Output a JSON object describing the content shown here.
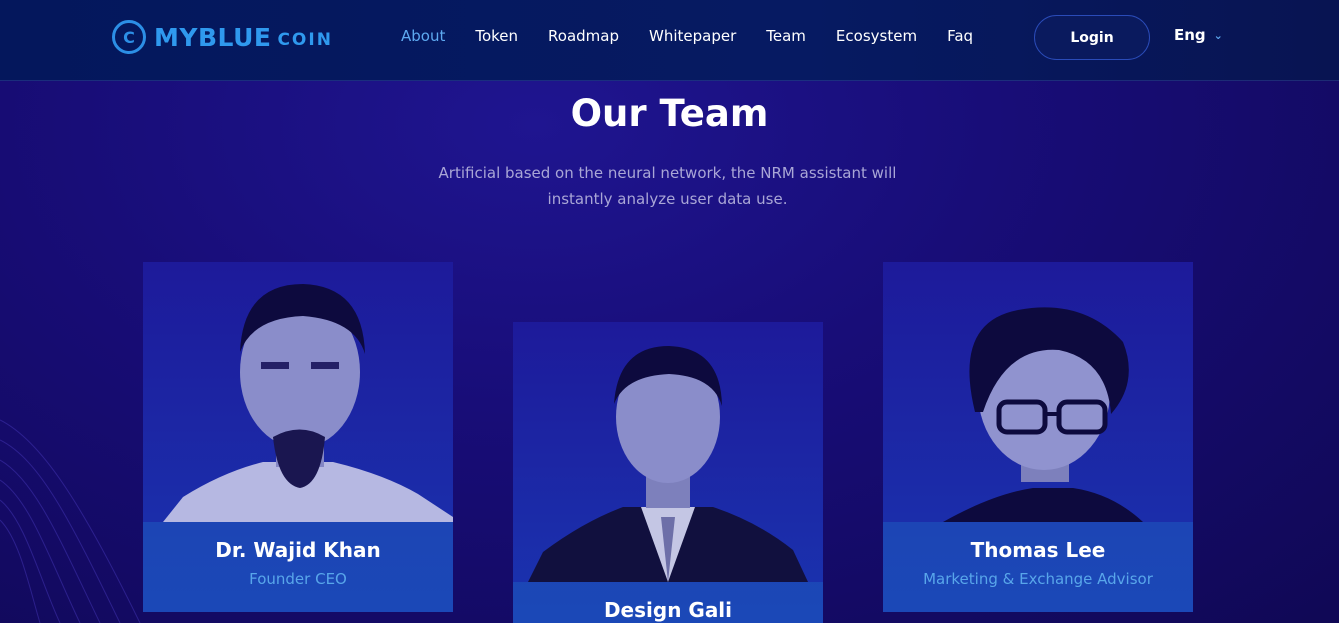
{
  "header": {
    "logo": {
      "main": "MYBLUE",
      "sub": "COIN",
      "mark": "C"
    },
    "nav": [
      "About",
      "Token",
      "Roadmap",
      "Whitepaper",
      "Team",
      "Ecosystem",
      "Faq"
    ],
    "active_nav": "About",
    "login_label": "Login",
    "language": "Eng"
  },
  "team": {
    "title": "Our Team",
    "subtitle_line1": "Artificial based on the neural network, the NRM assistant will",
    "subtitle_line2": "instantly analyze user data use.",
    "members": [
      {
        "name": "Dr. Wajid Khan",
        "role": "Founder CEO"
      },
      {
        "name": "Design Gali",
        "role": ""
      },
      {
        "name": "Thomas Lee",
        "role": "Marketing & Exchange Advisor"
      }
    ]
  },
  "colors": {
    "accent": "#2f99ee",
    "nav_active": "#5ea9f0",
    "background": "#180d78",
    "header_bg": "#061a62",
    "role_text": "#58a6ea"
  }
}
